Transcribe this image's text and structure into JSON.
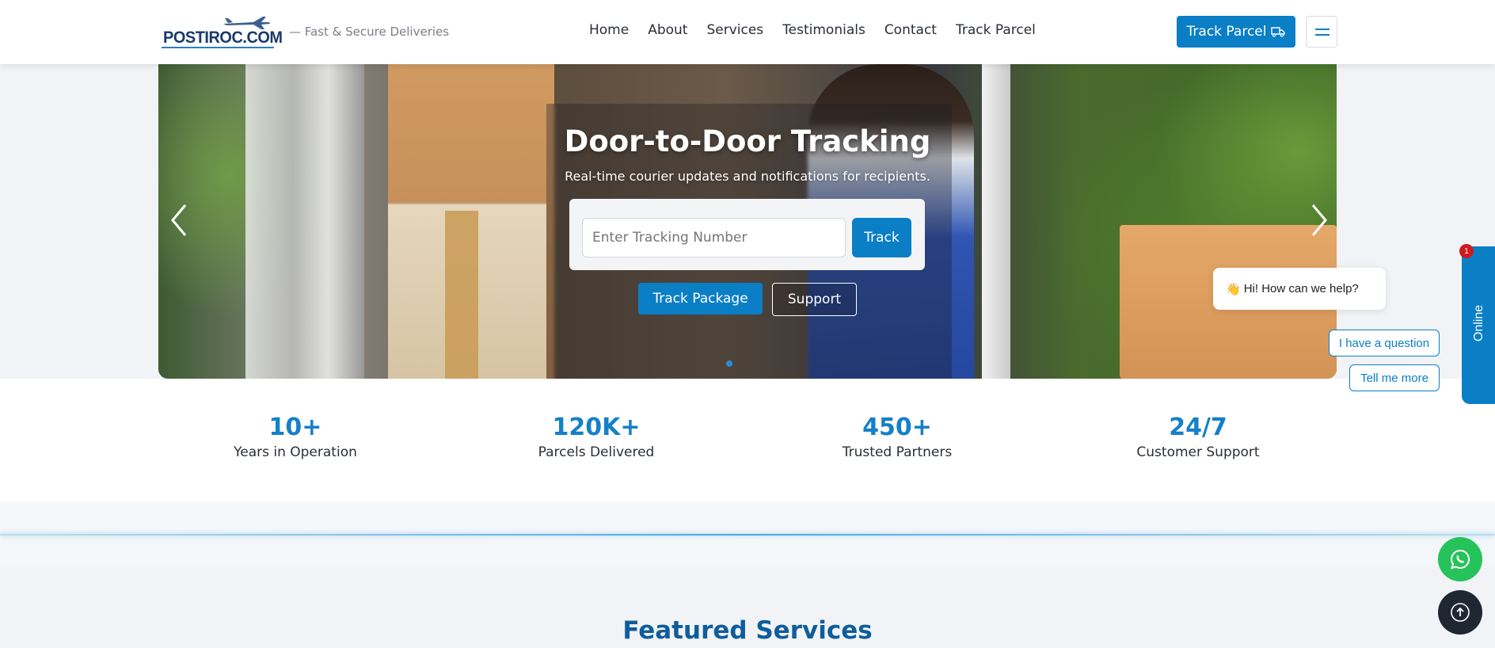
{
  "header": {
    "logo_text": "POSTIROC.COM",
    "tagline": "— Fast & Secure Deliveries",
    "nav": [
      {
        "label": "Home"
      },
      {
        "label": "About"
      },
      {
        "label": "Services"
      },
      {
        "label": "Testimonials"
      },
      {
        "label": "Contact"
      },
      {
        "label": "Track Parcel"
      }
    ],
    "track_button": "Track Parcel",
    "track_button_icon": "truck-icon",
    "menu_icon": "hamburger-icon"
  },
  "hero": {
    "title": "Door-to-Door Tracking",
    "subtitle": "Real-time courier updates and notifications for recipients.",
    "tracking_placeholder": "Enter Tracking Number",
    "track_button": "Track",
    "primary_button": "Track Package",
    "secondary_button": "Support",
    "active_slide": 1
  },
  "stats": [
    {
      "value": "10+",
      "label": "Years in Operation"
    },
    {
      "value": "120K+",
      "label": "Parcels Delivered"
    },
    {
      "value": "450+",
      "label": "Trusted Partners"
    },
    {
      "value": "24/7",
      "label": "Customer Support"
    }
  ],
  "featured": {
    "title": "Featured Services"
  },
  "chat": {
    "tab_label": "Online",
    "badge_count": "1",
    "greeting_emoji": "👋",
    "greeting": "Hi! How can we help?",
    "options": [
      "I have a question",
      "Tell me more"
    ]
  },
  "colors": {
    "accent": "#0a7fc6",
    "stat_number": "#1580c8",
    "featured_title": "#0f5d9b",
    "whatsapp": "#25c35a",
    "badge": "#d0191f"
  }
}
